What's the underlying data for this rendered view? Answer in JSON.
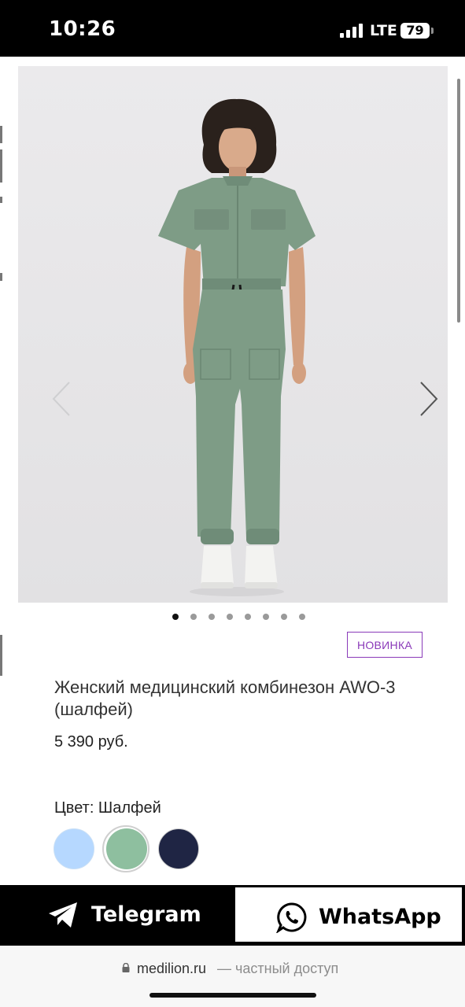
{
  "status_bar": {
    "time": "10:26",
    "network": "LTE",
    "battery": "79"
  },
  "product": {
    "badge": "НОВИНКА",
    "title": "Женский медицинский комбинезон AWO-3 (шалфей)",
    "price": "5 390 руб.",
    "color_label": "Цвет: Шалфей",
    "swatches": [
      {
        "name": "blue",
        "color": "#b6d8ff"
      },
      {
        "name": "sage",
        "color": "#8ebf9f",
        "selected": true
      },
      {
        "name": "navy",
        "color": "#1f2544"
      }
    ],
    "gallery": {
      "image_count": 8,
      "active_index": 1
    }
  },
  "messengers": {
    "telegram_label": "Telegram",
    "whatsapp_label": "WhatsApp"
  },
  "browser": {
    "domain": "medilion.ru",
    "note": "— частный доступ"
  }
}
